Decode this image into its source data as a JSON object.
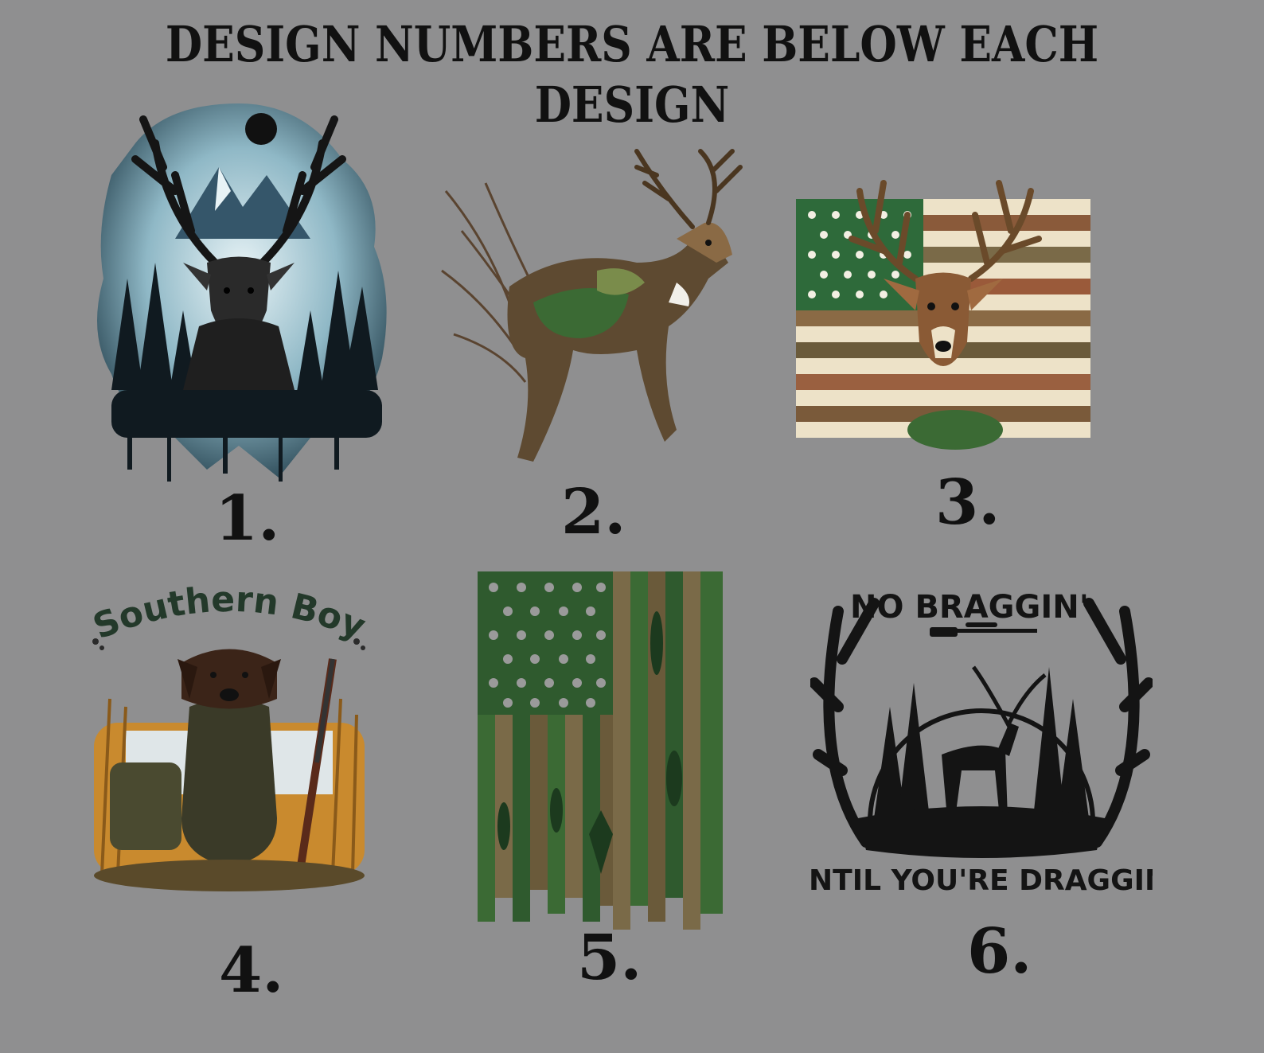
{
  "headline": "DESIGN NUMBERS ARE BELOW EACH DESIGN",
  "colors": {
    "background": "#8f8f90",
    "text": "#111111",
    "camo_green": "#2f5a2e",
    "camo_brown": "#7a5a3a",
    "ice_blue": "#9fc3cf"
  },
  "designs": [
    {
      "number": "1.",
      "icon": "mountain-stag-icon"
    },
    {
      "number": "2.",
      "icon": "leaping-camo-deer-icon"
    },
    {
      "number": "3.",
      "icon": "camo-flag-buck-icon"
    },
    {
      "number": "4.",
      "icon": "southern-boy-dog-icon",
      "title": "Southern Boy"
    },
    {
      "number": "5.",
      "icon": "fishing-flag-icon"
    },
    {
      "number": "6.",
      "icon": "antler-deer-silhouette-icon",
      "top_text": "NO BRAGGIN'",
      "bottom_text": "UNTIL YOU'RE DRAGGIN'"
    }
  ]
}
